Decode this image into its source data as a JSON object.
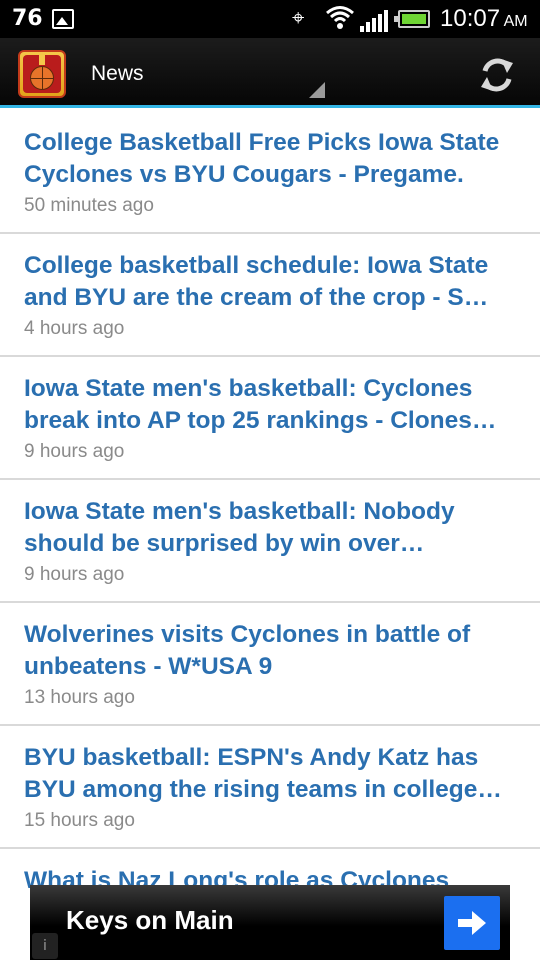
{
  "status_bar": {
    "battery_level": "76",
    "time": "10:07",
    "ampm": "AM",
    "icons": [
      "image-icon",
      "gps-icon",
      "wifi-icon",
      "signal-icon",
      "battery-icon"
    ]
  },
  "action_bar": {
    "title": "News",
    "app_icon": "basketball-trophy-icon",
    "refresh_icon": "refresh-icon"
  },
  "news": [
    {
      "title": "College Basketball Free Picks Iowa State Cyclones vs BYU Cougars - Pregame.",
      "time": "50 minutes ago"
    },
    {
      "title": "College basketball schedule: Iowa State and BYU are the cream of the crop - S…",
      "time": "4 hours ago"
    },
    {
      "title": "Iowa State men's basketball: Cyclones break into AP top 25 rankings - Clones…",
      "time": "9 hours ago"
    },
    {
      "title": "Iowa State men's basketball: Nobody should be surprised by win over…",
      "time": "9 hours ago"
    },
    {
      "title": "Wolverines visits Cyclones in battle of unbeatens - W*USA 9",
      "time": "13 hours ago"
    },
    {
      "title": "BYU basketball: ESPN's Andy Katz has BYU among the rising teams in college…",
      "time": "15 hours ago"
    },
    {
      "title": "What is Naz Long's role as Cyclones",
      "time": ""
    }
  ],
  "ad": {
    "text": "Keys on Main",
    "info_icon": "i",
    "arrow_icon": "arrow-right-icon"
  },
  "colors": {
    "headline": "#2a6fb0",
    "accent": "#33b5e5",
    "ad_button": "#1b6ff0"
  }
}
